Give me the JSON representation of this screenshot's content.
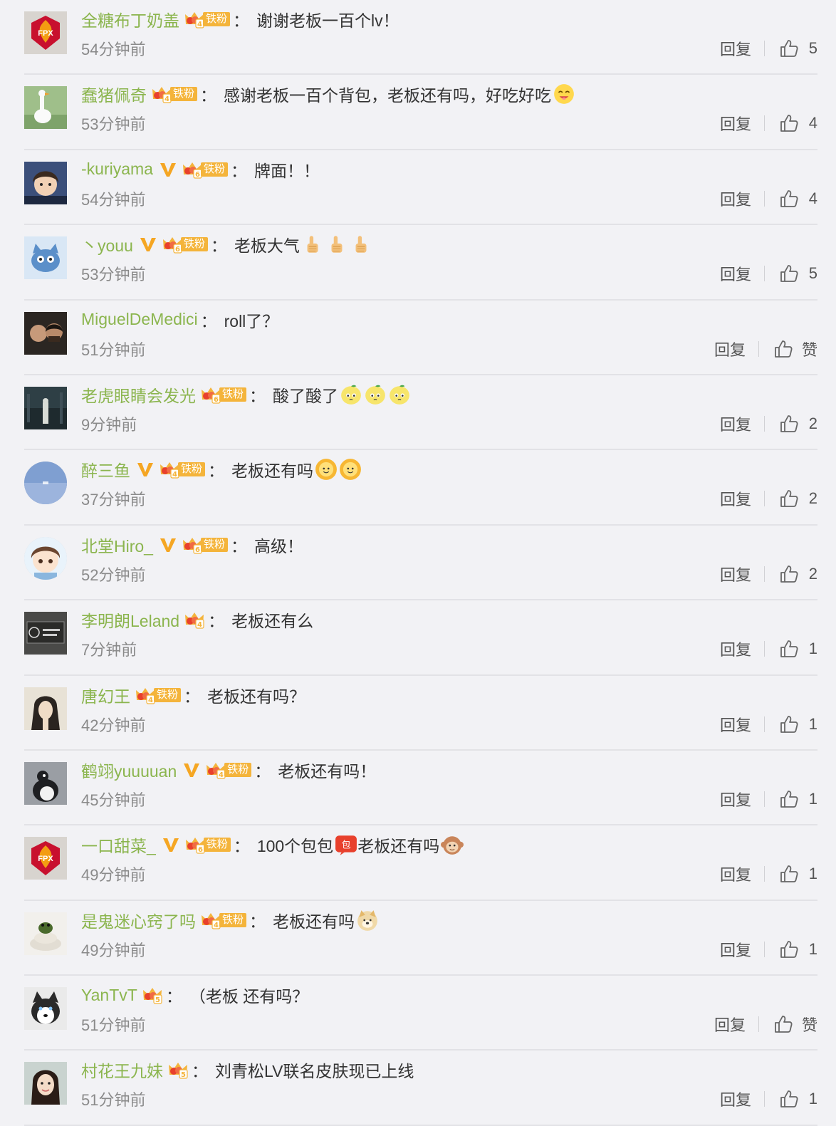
{
  "actions": {
    "reply": "回复",
    "like_empty": "赞"
  },
  "colors": {
    "username": "#8bb54e",
    "fan_badge": "#f4b43b",
    "verified": "#f5a623"
  },
  "comments": [
    {
      "user": "全糖布丁奶盖",
      "verified": false,
      "fan_level": "4",
      "fan_tag": "铁粉",
      "text": "谢谢老板一百个lv！",
      "emojis": [],
      "time": "54分钟前",
      "likes": "5",
      "avatar": "fpx-logo"
    },
    {
      "user": "蠢猪佩奇",
      "verified": false,
      "fan_level": "4",
      "fan_tag": "铁粉",
      "text": "感谢老板一百个背包，老板还有吗，好吃好吃",
      "emojis": [
        "yum-face-emoji"
      ],
      "time": "53分钟前",
      "likes": "4",
      "avatar": "goose-photo"
    },
    {
      "user": "-kuriyama",
      "verified": true,
      "fan_level": "6",
      "fan_tag": "铁粉",
      "text": "牌面！！",
      "emojis": [],
      "time": "54分钟前",
      "likes": "4",
      "avatar": "anime-boy"
    },
    {
      "user": "丶youu",
      "verified": true,
      "fan_level": "6",
      "fan_tag": "铁粉",
      "text": "老板大气",
      "emojis": [
        "thumbs-up-emoji",
        "thumbs-up-emoji",
        "thumbs-up-emoji"
      ],
      "time": "53分钟前",
      "likes": "5",
      "avatar": "cartoon-cat"
    },
    {
      "user": "MiguelDeMedici",
      "verified": false,
      "fan_level": "",
      "fan_tag": "",
      "text": "roll了？",
      "emojis": [],
      "time": "51分钟前",
      "likes": "赞",
      "avatar": "two-people-photo"
    },
    {
      "user": "老虎眼睛会发光",
      "verified": false,
      "fan_level": "6",
      "fan_tag": "铁粉",
      "text": "酸了酸了",
      "emojis": [
        "lemon-face-emoji",
        "lemon-face-emoji",
        "lemon-face-emoji"
      ],
      "time": "9分钟前",
      "likes": "2",
      "avatar": "night-street-photo"
    },
    {
      "user": "醉三鱼",
      "verified": true,
      "fan_level": "4",
      "fan_tag": "铁粉",
      "text": "老板还有吗",
      "emojis": [
        "sunflower-face-emoji",
        "sunflower-face-emoji"
      ],
      "time": "37分钟前",
      "likes": "2",
      "avatar": "blue-sky-circle"
    },
    {
      "user": "北堂Hiro_",
      "verified": true,
      "fan_level": "6",
      "fan_tag": "铁粉",
      "text": "高级！",
      "emojis": [],
      "time": "52分钟前",
      "likes": "2",
      "avatar": "chibi-boy-circle"
    },
    {
      "user": "李明朗Leland",
      "verified": false,
      "fan_level": "4",
      "fan_tag": "",
      "text": "老板还有么",
      "emojis": [],
      "time": "7分钟前",
      "likes": "1",
      "avatar": "sign-board-photo"
    },
    {
      "user": "唐幻王",
      "verified": false,
      "fan_level": "4",
      "fan_tag": "铁粉",
      "text": "老板还有吗？",
      "emojis": [],
      "time": "42分钟前",
      "likes": "1",
      "avatar": "manga-character"
    },
    {
      "user": "鹤翊yuuuuan",
      "verified": true,
      "fan_level": "4",
      "fan_tag": "铁粉",
      "text": "老板还有吗！",
      "emojis": [],
      "time": "45分钟前",
      "likes": "1",
      "avatar": "penguin-photo"
    },
    {
      "user": "一口甜菜_",
      "verified": true,
      "fan_level": "6",
      "fan_tag": "铁粉",
      "text": "100个包包",
      "text2": "老板还有吗",
      "emojis": [
        "baobao-sticker"
      ],
      "emojis2": [
        "monkey-emoji"
      ],
      "time": "49分钟前",
      "likes": "1",
      "avatar": "fpx-logo"
    },
    {
      "user": "是鬼迷心窍了吗",
      "verified": false,
      "fan_level": "4",
      "fan_tag": "铁粉",
      "text": "老板还有吗",
      "emojis": [
        "doge-emoji"
      ],
      "time": "49分钟前",
      "likes": "1",
      "avatar": "frog-cake-photo"
    },
    {
      "user": "YanTvT",
      "verified": false,
      "fan_level": "5",
      "fan_tag": "",
      "text": "（老板 还有吗？",
      "emojis": [],
      "time": "51分钟前",
      "likes": "赞",
      "avatar": "husky-photo"
    },
    {
      "user": "村花王九妹",
      "verified": false,
      "fan_level": "5",
      "fan_tag": "",
      "text": "刘青松LV联名皮肤现已上线",
      "emojis": [],
      "time": "51分钟前",
      "likes": "1",
      "avatar": "girl-portrait"
    }
  ]
}
